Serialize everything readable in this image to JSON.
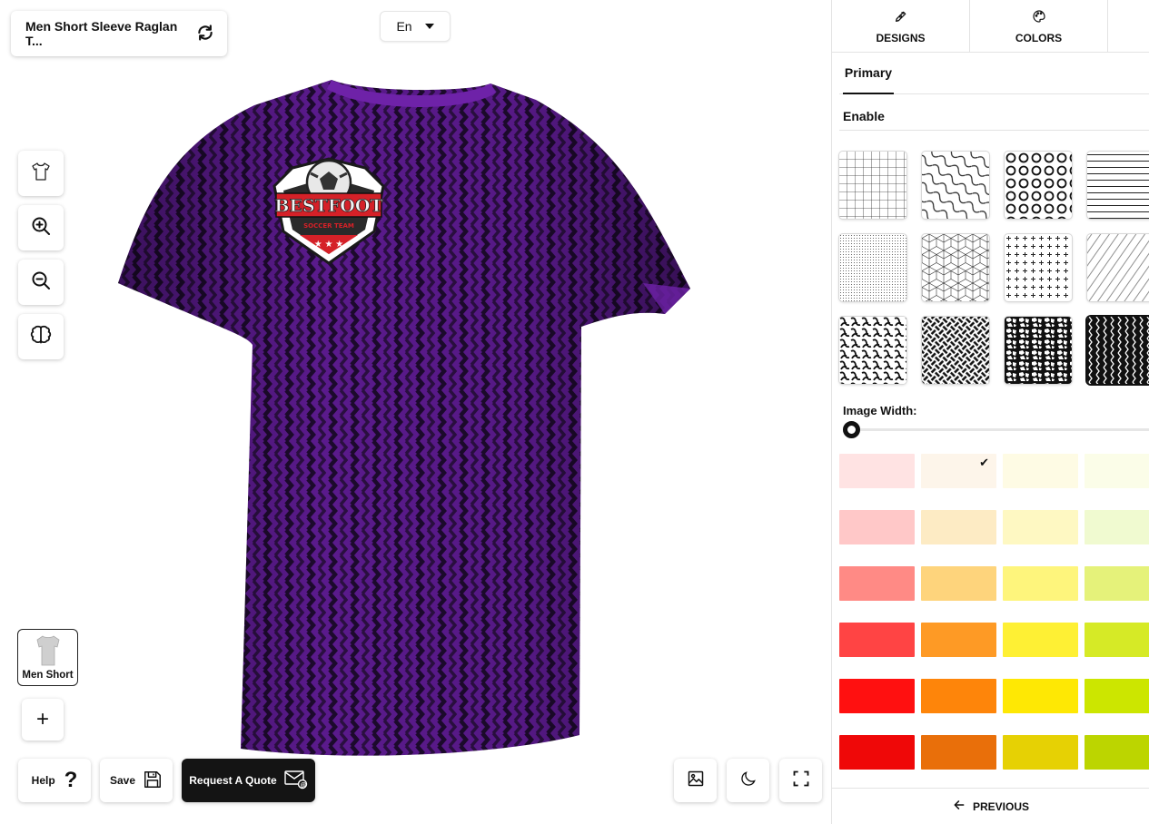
{
  "header": {
    "product_title": "Men Short Sleeve Raglan T...",
    "language": "En"
  },
  "toolbar": {
    "tools": [
      {
        "name": "shirt-view-icon"
      },
      {
        "name": "zoom-in-icon"
      },
      {
        "name": "zoom-out-icon"
      },
      {
        "name": "brain-icon"
      }
    ]
  },
  "products": {
    "thumb_label": "Men Short",
    "add": "+"
  },
  "actions": {
    "help": "Help",
    "help_icon": "?",
    "save": "Save",
    "quote": "Request A Quote"
  },
  "shirt": {
    "logo_text": "BESTFOOT",
    "logo_sub": "SOCCER TEAM",
    "body_color": "#5a1a8c",
    "stripe_color": "#1c0a2c"
  },
  "panel": {
    "tabs": [
      {
        "label": "DESIGNS",
        "icon": "pen-icon"
      },
      {
        "label": "COLORS",
        "icon": "palette-icon"
      }
    ],
    "subtab": "Primary",
    "enable": "Enable",
    "image_width_label": "Image Width:",
    "image_width_value": 0,
    "previous": "PREVIOUS",
    "patterns": [
      "grid",
      "waves",
      "circles",
      "lines",
      "dots",
      "cubes",
      "crosses",
      "diagonal",
      "maze",
      "weave",
      "voronoi",
      "zigzag"
    ],
    "selected_pattern": 11,
    "swatches": [
      [
        "#ffe3e3",
        "#fdf5ea",
        "#fefbe4",
        "#fbfde8"
      ],
      [
        "#ffc8c8",
        "#fdebc4",
        "#fef8c2",
        "#f0fad0"
      ],
      [
        "#ff8a85",
        "#fed47c",
        "#fef57c",
        "#e5f27a"
      ],
      [
        "#ff4444",
        "#fe9a25",
        "#fef034",
        "#d6ea26"
      ],
      [
        "#ff1010",
        "#fe850a",
        "#fee804",
        "#cce600"
      ],
      [
        "#ef0808",
        "#e96f0a",
        "#e6d104",
        "#bcd500"
      ]
    ],
    "selected_swatch": [
      0,
      1
    ]
  }
}
